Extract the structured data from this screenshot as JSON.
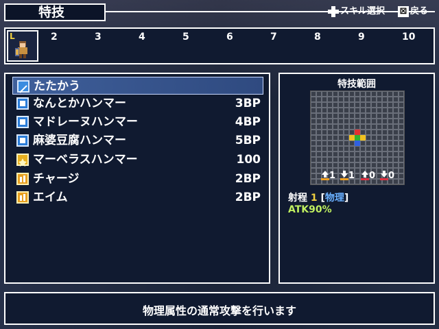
{
  "header": {
    "title": "特技",
    "hint_skill_select": "スキル選択",
    "hint_back": "戻る",
    "back_button_glyph": "⊠"
  },
  "levels": [
    "2",
    "3",
    "4",
    "5",
    "6",
    "7",
    "8",
    "9",
    "10"
  ],
  "character": {
    "level_marker": "L"
  },
  "skills": [
    {
      "name": "たたかう",
      "cost": "",
      "icon": "sword-icon",
      "selected": true
    },
    {
      "name": "なんとかハンマー",
      "cost": "3BP",
      "icon": "hammer-icon",
      "selected": false
    },
    {
      "name": "マドレーヌハンマー",
      "cost": "4BP",
      "icon": "hammer-icon",
      "selected": false
    },
    {
      "name": "麻婆豆腐ハンマー",
      "cost": "5BP",
      "icon": "hammer-icon",
      "selected": false
    },
    {
      "name": "マーベラスハンマー",
      "cost": "100",
      "icon": "special-icon",
      "selected": false
    },
    {
      "name": "チャージ",
      "cost": "2BP",
      "icon": "buff-icon",
      "selected": false
    },
    {
      "name": "エイム",
      "cost": "2BP",
      "icon": "buff-icon",
      "selected": false
    }
  ],
  "range": {
    "title": "特技範囲",
    "effects": [
      {
        "value": "1",
        "icon": "up-arrow-icon"
      },
      {
        "value": "1",
        "icon": "down-arrow-icon"
      },
      {
        "value": "0",
        "icon": "up-arrow-icon"
      },
      {
        "value": "0",
        "icon": "down-arrow-icon"
      }
    ],
    "range_label": "射程",
    "range_value": "1",
    "range_type": "物理",
    "attack": "ATK90%"
  },
  "description": "物理属性の通常攻撃を行います",
  "colors": {
    "panel_bg": "#101a30",
    "highlight": "#3f5f9a",
    "gold": "#f0d040",
    "blue_text": "#6ab0ff",
    "green_text": "#c0f060"
  }
}
